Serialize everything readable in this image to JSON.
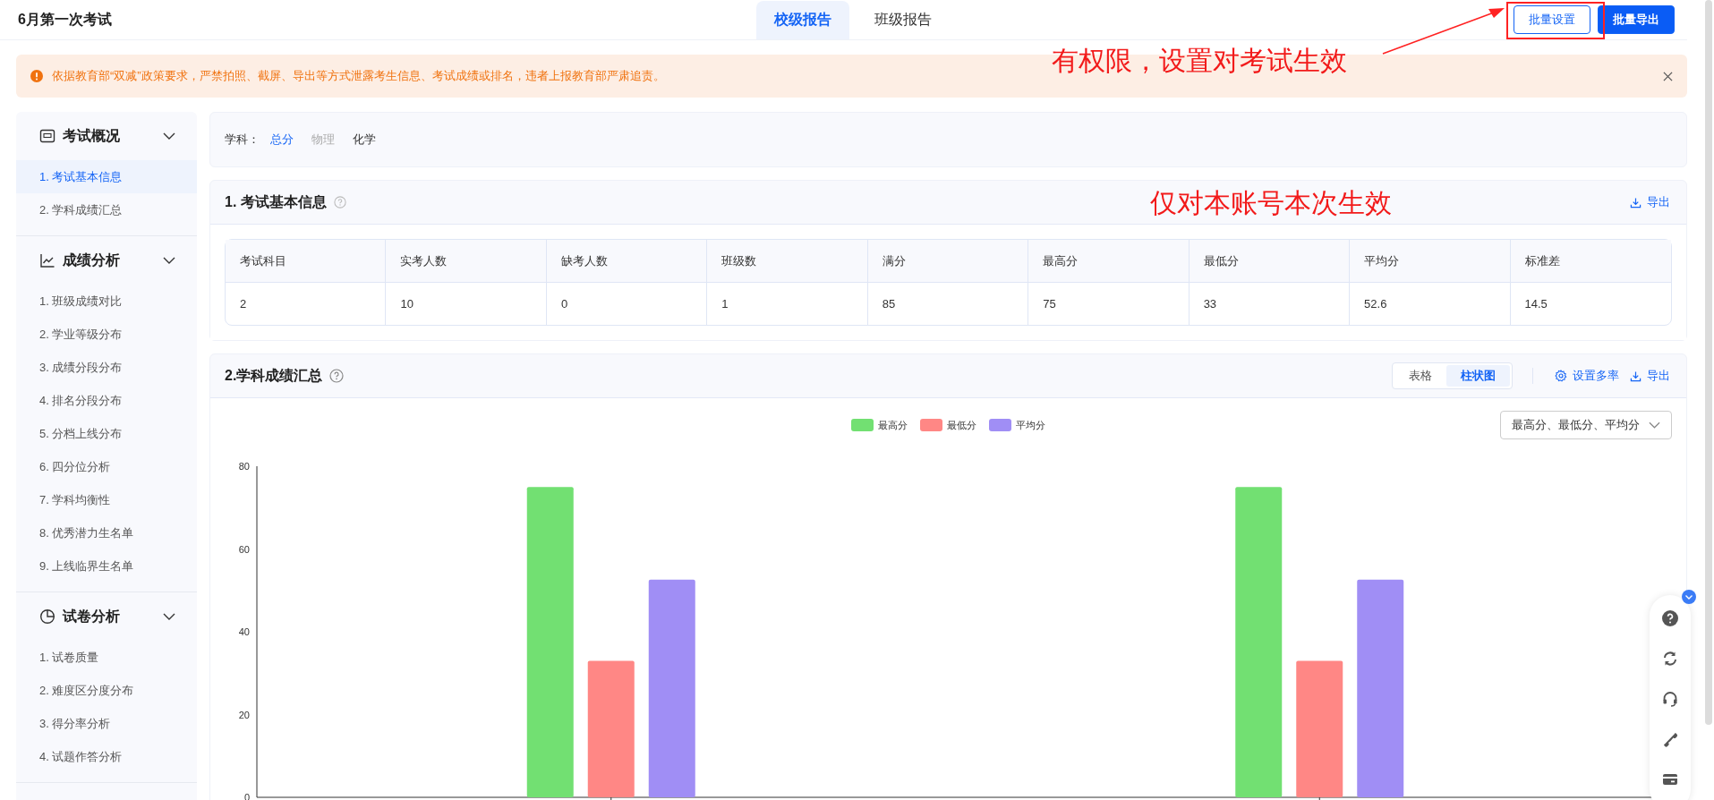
{
  "header": {
    "title": "6月第一次考试",
    "tabs": [
      {
        "label": "校级报告",
        "selected": true
      },
      {
        "label": "班级报告",
        "selected": false
      }
    ],
    "buttons": [
      {
        "label": "批量设置",
        "kind": "outline"
      },
      {
        "label": "批量导出",
        "kind": "primary"
      }
    ]
  },
  "notice": {
    "text": "依据教育部“双减”政策要求，严禁拍照、截屏、导出等方式泄露考生信息、考试成绩或排名，违者上报教育部严肃追责。"
  },
  "sidebar": {
    "groups": [
      {
        "title": "考试概况",
        "expanded": true,
        "items": [
          {
            "label": "1. 考试基本信息",
            "selected": true
          },
          {
            "label": "2. 学科成绩汇总",
            "selected": false
          }
        ]
      },
      {
        "title": "成绩分析",
        "expanded": true,
        "items": [
          {
            "label": "1. 班级成绩对比",
            "selected": false
          },
          {
            "label": "2. 学业等级分布",
            "selected": false
          },
          {
            "label": "3. 成绩分段分布",
            "selected": false
          },
          {
            "label": "4. 排名分段分布",
            "selected": false
          },
          {
            "label": "5. 分档上线分布",
            "selected": false
          },
          {
            "label": "6. 四分位分析",
            "selected": false
          },
          {
            "label": "7. 学科均衡性",
            "selected": false
          },
          {
            "label": "8. 优秀潜力生名单",
            "selected": false
          },
          {
            "label": "9. 上线临界生名单",
            "selected": false
          }
        ]
      },
      {
        "title": "试卷分析",
        "expanded": true,
        "items": [
          {
            "label": "1. 试卷质量",
            "selected": false
          },
          {
            "label": "2. 难度区分度分布",
            "selected": false
          },
          {
            "label": "3. 得分率分析",
            "selected": false
          },
          {
            "label": "4. 试题作答分析",
            "selected": false
          }
        ]
      }
    ]
  },
  "subject_filter": {
    "label": "学科：",
    "options": [
      {
        "label": "总分",
        "selected": true,
        "disabled": false
      },
      {
        "label": "物理",
        "selected": false,
        "disabled": true
      },
      {
        "label": "化学",
        "selected": false,
        "disabled": false
      }
    ]
  },
  "basic_info": {
    "title": "1. 考试基本信息",
    "export": "导出",
    "table": {
      "columns": [
        "考试科目",
        "实考人数",
        "缺考人数",
        "班级数",
        "满分",
        "最高分",
        "最低分",
        "平均分",
        "标准差"
      ],
      "rows": [
        [
          "2",
          "10",
          "0",
          "1",
          "85",
          "75",
          "33",
          "52.6",
          "14.5"
        ]
      ]
    }
  },
  "subject_summary": {
    "title": "2.学科成绩汇总",
    "view_toggle": [
      {
        "label": "表格",
        "selected": false
      },
      {
        "label": "柱状图",
        "selected": true
      }
    ],
    "settings": "设置多率",
    "export": "导出",
    "series_select": "最高分、最低分、平均分",
    "chart_data": {
      "type": "bar",
      "series": [
        {
          "name": "最高分",
          "color": "#72e072",
          "values": [
            75,
            75
          ]
        },
        {
          "name": "最低分",
          "color": "#ff8785",
          "values": [
            33,
            33
          ]
        },
        {
          "name": "平均分",
          "color": "#a08ef5",
          "values": [
            52.6,
            52.6
          ]
        }
      ],
      "ylim": [
        0,
        80
      ],
      "yticks": [
        0,
        20,
        40,
        60,
        80
      ]
    }
  },
  "annotations": [
    {
      "text": "有权限，设置对考试生效"
    },
    {
      "text": "仅对本账号本次生效"
    }
  ]
}
